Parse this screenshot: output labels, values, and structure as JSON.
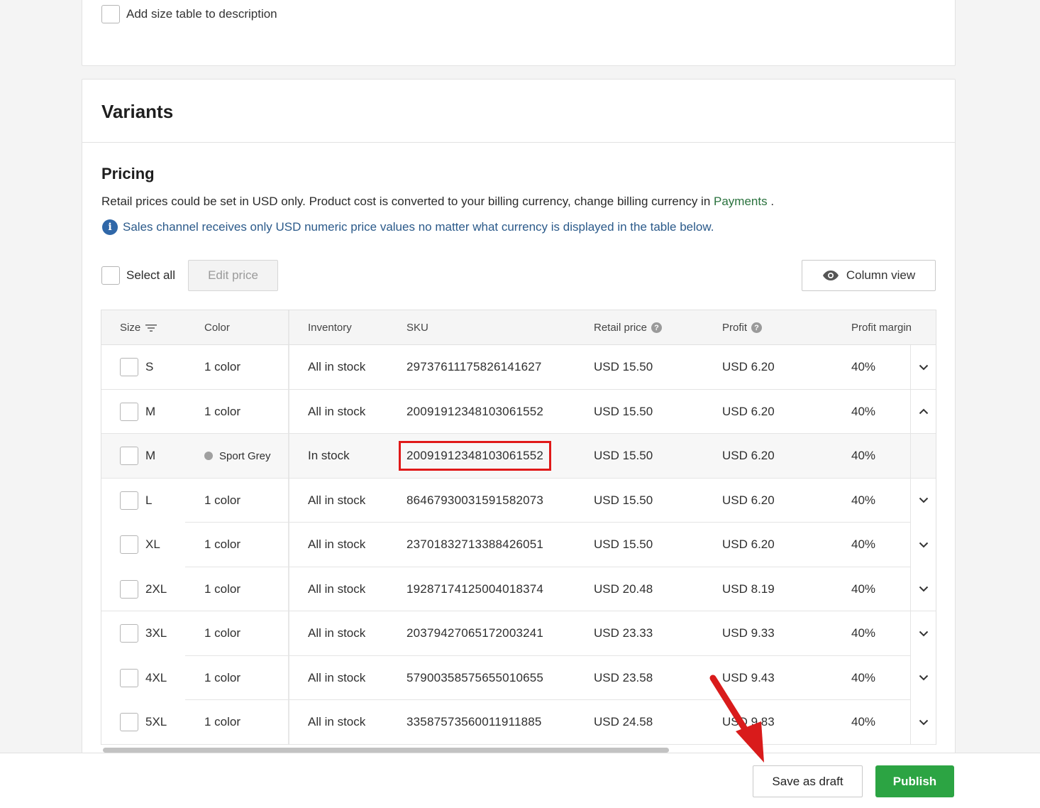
{
  "size_table": {
    "label": "Add size table to description"
  },
  "variants": {
    "title": "Variants"
  },
  "pricing": {
    "title": "Pricing",
    "description": "Retail prices could be set in USD only. Product cost is converted to your billing currency, change billing currency in",
    "payments_link": "Payments",
    "after_link": " .",
    "info": "Sales channel receives only USD numeric price values no matter what currency is displayed in the table below."
  },
  "toolbar": {
    "select_all": "Select all",
    "edit_price": "Edit price",
    "column_view": "Column view"
  },
  "table": {
    "headers": {
      "size": "Size",
      "color": "Color",
      "inventory": "Inventory",
      "sku": "SKU",
      "retail_price": "Retail price",
      "profit": "Profit",
      "profit_margin": "Profit margin"
    },
    "rows": [
      {
        "size": "S",
        "color": "1 color",
        "inventory": "All in stock",
        "sku": "29737611175826141627",
        "retail": "USD 15.50",
        "profit": "USD 6.20",
        "margin": "40%",
        "chevron": "down"
      },
      {
        "size": "M",
        "color": "1 color",
        "inventory": "All in stock",
        "sku": "20091912348103061552",
        "retail": "USD 15.50",
        "profit": "USD 6.20",
        "margin": "40%",
        "chevron": "up"
      },
      {
        "size": "M",
        "color": "Sport Grey",
        "inventory": "In stock",
        "sku": "20091912348103061552",
        "retail": "USD 15.50",
        "profit": "USD 6.20",
        "margin": "40%",
        "chevron": ""
      },
      {
        "size": "L",
        "color": "1 color",
        "inventory": "All in stock",
        "sku": "86467930031591582073",
        "retail": "USD 15.50",
        "profit": "USD 6.20",
        "margin": "40%",
        "chevron": "down"
      },
      {
        "size": "XL",
        "color": "1 color",
        "inventory": "All in stock",
        "sku": "23701832713388426051",
        "retail": "USD 15.50",
        "profit": "USD 6.20",
        "margin": "40%",
        "chevron": "down"
      },
      {
        "size": "2XL",
        "color": "1 color",
        "inventory": "All in stock",
        "sku": "19287174125004018374",
        "retail": "USD 20.48",
        "profit": "USD 8.19",
        "margin": "40%",
        "chevron": "down"
      },
      {
        "size": "3XL",
        "color": "1 color",
        "inventory": "All in stock",
        "sku": "20379427065172003241",
        "retail": "USD 23.33",
        "profit": "USD 9.33",
        "margin": "40%",
        "chevron": "down"
      },
      {
        "size": "4XL",
        "color": "1 color",
        "inventory": "All in stock",
        "sku": "57900358575655010655",
        "retail": "USD 23.58",
        "profit": "USD 9.43",
        "margin": "40%",
        "chevron": "down"
      },
      {
        "size": "5XL",
        "color": "1 color",
        "inventory": "All in stock",
        "sku": "33587573560011911885",
        "retail": "USD 24.58",
        "profit": "USD 9.83",
        "margin": "40%",
        "chevron": "down"
      }
    ]
  },
  "footer": {
    "save_draft": "Save as draft",
    "publish": "Publish"
  },
  "colors": {
    "accent_green": "#2ca443",
    "link_green": "#29713d",
    "info_blue": "#2b5a8a",
    "highlight_red": "#e01919"
  }
}
